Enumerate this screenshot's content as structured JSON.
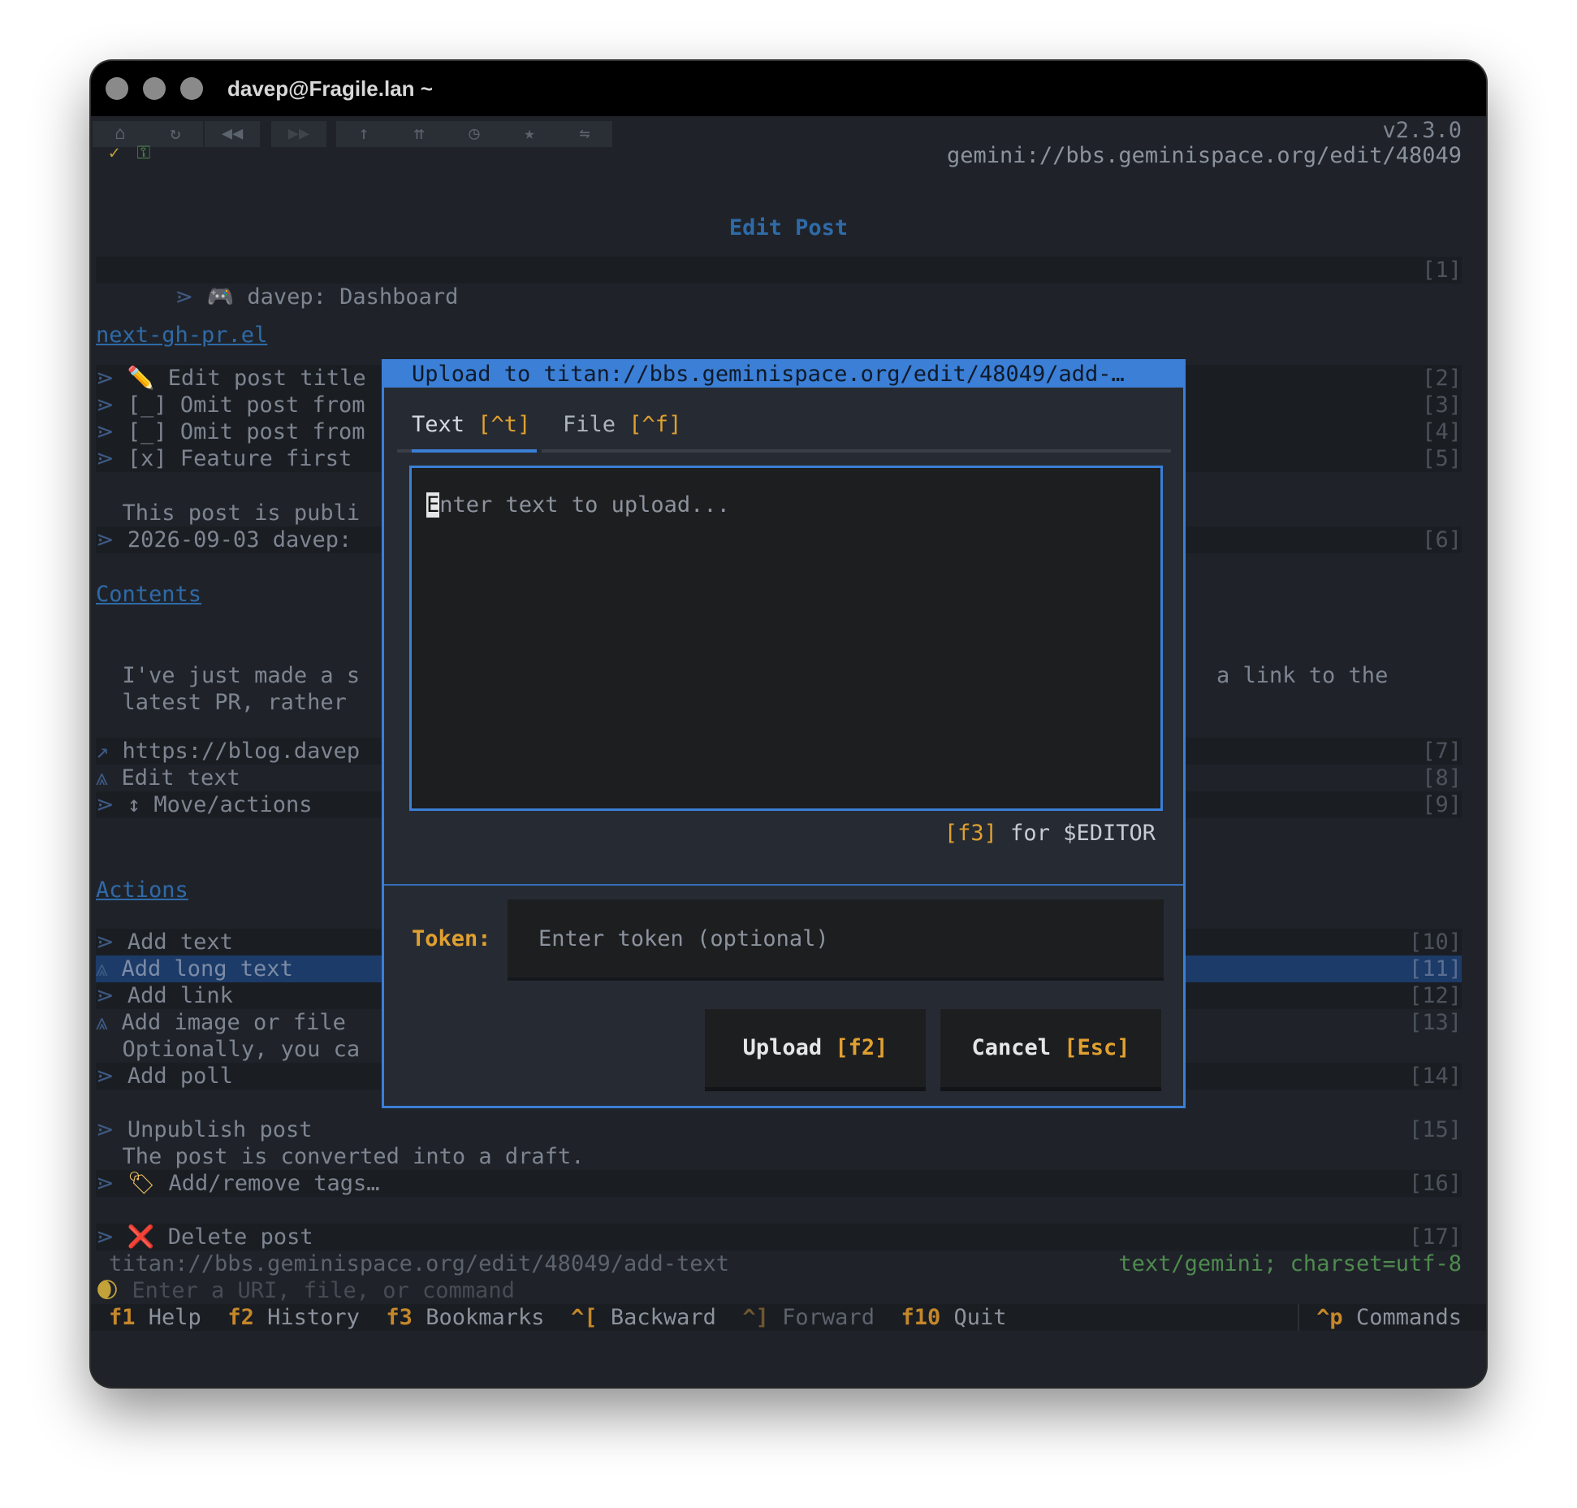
{
  "window": {
    "title": "davep@Fragile.lan ~"
  },
  "toolbar": {
    "buttons": [
      {
        "icon": "⌂",
        "name": "home-icon"
      },
      {
        "icon": "↻",
        "name": "reload-icon"
      },
      {
        "icon": "◀◀",
        "name": "backward-icon"
      },
      {
        "icon": "▶▶",
        "name": "forward-icon"
      },
      {
        "icon": "↑",
        "name": "up-icon"
      },
      {
        "icon": "⇈",
        "name": "root-icon"
      },
      {
        "icon": "◷",
        "name": "history-icon"
      },
      {
        "icon": "★",
        "name": "bookmark-icon"
      },
      {
        "icon": "⇋",
        "name": "swap-icon"
      }
    ],
    "version": "v2.3.0",
    "url": "gemini://bbs.geminispace.org/edit/48049",
    "check_icon": "✓",
    "cert_icon": "⚿"
  },
  "page": {
    "heading": "Edit Post",
    "dashboard": {
      "arrow": "⋗",
      "icon": "🎮",
      "text": "davep: Dashboard",
      "num": "[1]"
    },
    "section1": "next-gh-pr.el",
    "items1": [
      {
        "arrow": "⋗",
        "text": "✏️ Edit post title",
        "num": "[2]"
      },
      {
        "arrow": "⋗",
        "text": "[_] Omit post from",
        "num": "[3]"
      },
      {
        "arrow": "⋗",
        "text": "[_] Omit post from",
        "num": "[4]"
      },
      {
        "arrow": "⋗",
        "text": "[x] Feature first",
        "num": "[5]"
      }
    ],
    "published": "This post is publi",
    "dated": {
      "arrow": "⋗",
      "text": "2026-09-03 davep:",
      "num": "[6]"
    },
    "contents": "Contents",
    "body_line1_left": "I've just made a s",
    "body_line1_right": "a link to the",
    "body_line2": "latest PR, rather",
    "links": [
      {
        "arrow": "↗",
        "text": "https://blog.davep",
        "num": "[7]"
      },
      {
        "arrow": "⩓",
        "text": "Edit text",
        "num": "[8]"
      },
      {
        "arrow": "⋗",
        "text": "↕ Move/actions",
        "num": "[9]"
      }
    ],
    "actions": "Actions",
    "actions_items": [
      {
        "arrow": "⋗",
        "text": "Add text",
        "num": "[10]"
      },
      {
        "arrow": "⩓",
        "text": "Add long text",
        "num": "[11]"
      },
      {
        "arrow": "⋗",
        "text": "Add link",
        "num": "[12]"
      },
      {
        "arrow": "⩓",
        "text": "Add image or file",
        "num": "[13]"
      }
    ],
    "optional_note": "Optionally, you ca",
    "poll": {
      "arrow": "⋗",
      "text": "Add poll",
      "num": "[14]"
    },
    "unpublish": {
      "arrow": "⋗",
      "text": "Unpublish post",
      "num": "[15]"
    },
    "unpublish_note": "The post is converted into a draft.",
    "tags": {
      "arrow": "⋗",
      "icon": "🏷",
      "text": "Add/remove tags…",
      "num": "[16]"
    },
    "delete": {
      "arrow": "⋗",
      "icon": "❌",
      "text": "Delete post",
      "num": "[17]"
    }
  },
  "status": {
    "url": "titan://bbs.geminispace.org/edit/48049/add-text",
    "mime": "text/gemini; charset=utf-8",
    "command_placeholder": "Enter a URI, file, or command",
    "moon_icon": "🌒"
  },
  "footer": {
    "items": [
      {
        "key": "f1",
        "label": "Help"
      },
      {
        "key": "f2",
        "label": "History"
      },
      {
        "key": "f3",
        "label": "Bookmarks"
      },
      {
        "key": "^[",
        "label": "Backward"
      },
      {
        "key": "^]",
        "label": "Forward"
      },
      {
        "key": "f10",
        "label": "Quit"
      }
    ],
    "commands_key": "^p",
    "commands_label": "Commands"
  },
  "dialog": {
    "title": "Upload to titan://bbs.geminispace.org/edit/48049/add-…",
    "tab_text": "Text",
    "tab_text_key": "[^t]",
    "tab_file": "File",
    "tab_file_key": "[^f]",
    "text_placeholder_first": "E",
    "text_placeholder_rest": "nter text to upload...",
    "editor_key": "[f3]",
    "editor_hint": " for $EDITOR",
    "token_label": "Token:",
    "token_placeholder": "Enter token (optional)",
    "upload_label": "Upload",
    "upload_key": "[f2]",
    "cancel_label": "Cancel",
    "cancel_key": "[Esc]"
  }
}
